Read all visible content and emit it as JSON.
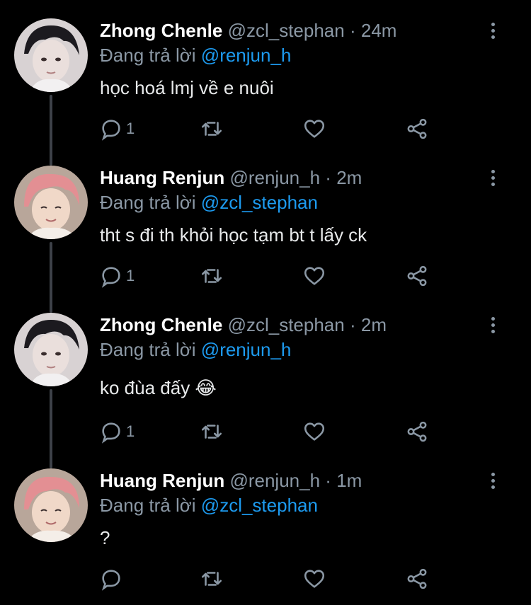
{
  "tweets": [
    {
      "name": "Zhong Chenle",
      "handle": "@zcl_stephan",
      "dot": "·",
      "time": "24m",
      "reply_prefix": "Đang trả lời",
      "reply_to": "@renjun_h",
      "text": "học hoá lmj về e nuôi",
      "reply_count": "1",
      "avatar": "dark-hair-avatar"
    },
    {
      "name": "Huang Renjun",
      "handle": "@renjun_h",
      "dot": "·",
      "time": "2m",
      "reply_prefix": "Đang trả lời",
      "reply_to": "@zcl_stephan",
      "text": "tht s đi th khỏi học tạm bt t lấy ck",
      "reply_count": "1",
      "avatar": "pink-hair-avatar"
    },
    {
      "name": "Zhong Chenle",
      "handle": "@zcl_stephan",
      "dot": "·",
      "time": "2m",
      "reply_prefix": "Đang trả lời",
      "reply_to": "@renjun_h",
      "text": "ko đùa đấy 😂",
      "reply_count": "1",
      "avatar": "dark-hair-avatar"
    },
    {
      "name": "Huang Renjun",
      "handle": "@renjun_h",
      "dot": "·",
      "time": "1m",
      "reply_prefix": "Đang trả lời",
      "reply_to": "@zcl_stephan",
      "text": "?",
      "reply_count": "",
      "avatar": "pink-hair-avatar"
    }
  ],
  "colors": {
    "background": "#000000",
    "name": "#ffffff",
    "muted": "#8b98a5",
    "mention": "#1d9bf0",
    "thread_line": "#3d4148"
  },
  "icons": [
    "reply-icon",
    "retweet-icon",
    "like-icon",
    "share-icon",
    "more-icon"
  ]
}
